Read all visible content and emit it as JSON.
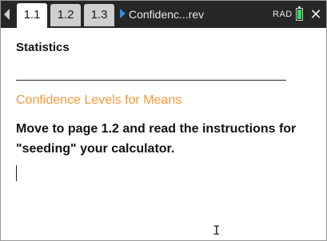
{
  "titlebar": {
    "tabs": [
      {
        "label": "1.1",
        "active": true
      },
      {
        "label": "1.2",
        "active": false
      },
      {
        "label": "1.3",
        "active": false
      }
    ],
    "document_title": "Confidenc...rev",
    "angle_mode": "RAD",
    "battery_level": 1.0,
    "icons": {
      "nav": "chevron-left-icon",
      "doc": "play-icon",
      "battery": "battery-icon",
      "close": "close-icon"
    }
  },
  "page": {
    "heading": "Statistics",
    "subtitle": "Confidence Levels for Means",
    "body": "Move to page 1.2 and read the instructions for \"seeding\" your calculator."
  },
  "colors": {
    "titlebar_bg": "#262626",
    "subtitle": "#f39a3c",
    "doc_icon": "#2f8fde",
    "battery": "#2fdc5a"
  }
}
